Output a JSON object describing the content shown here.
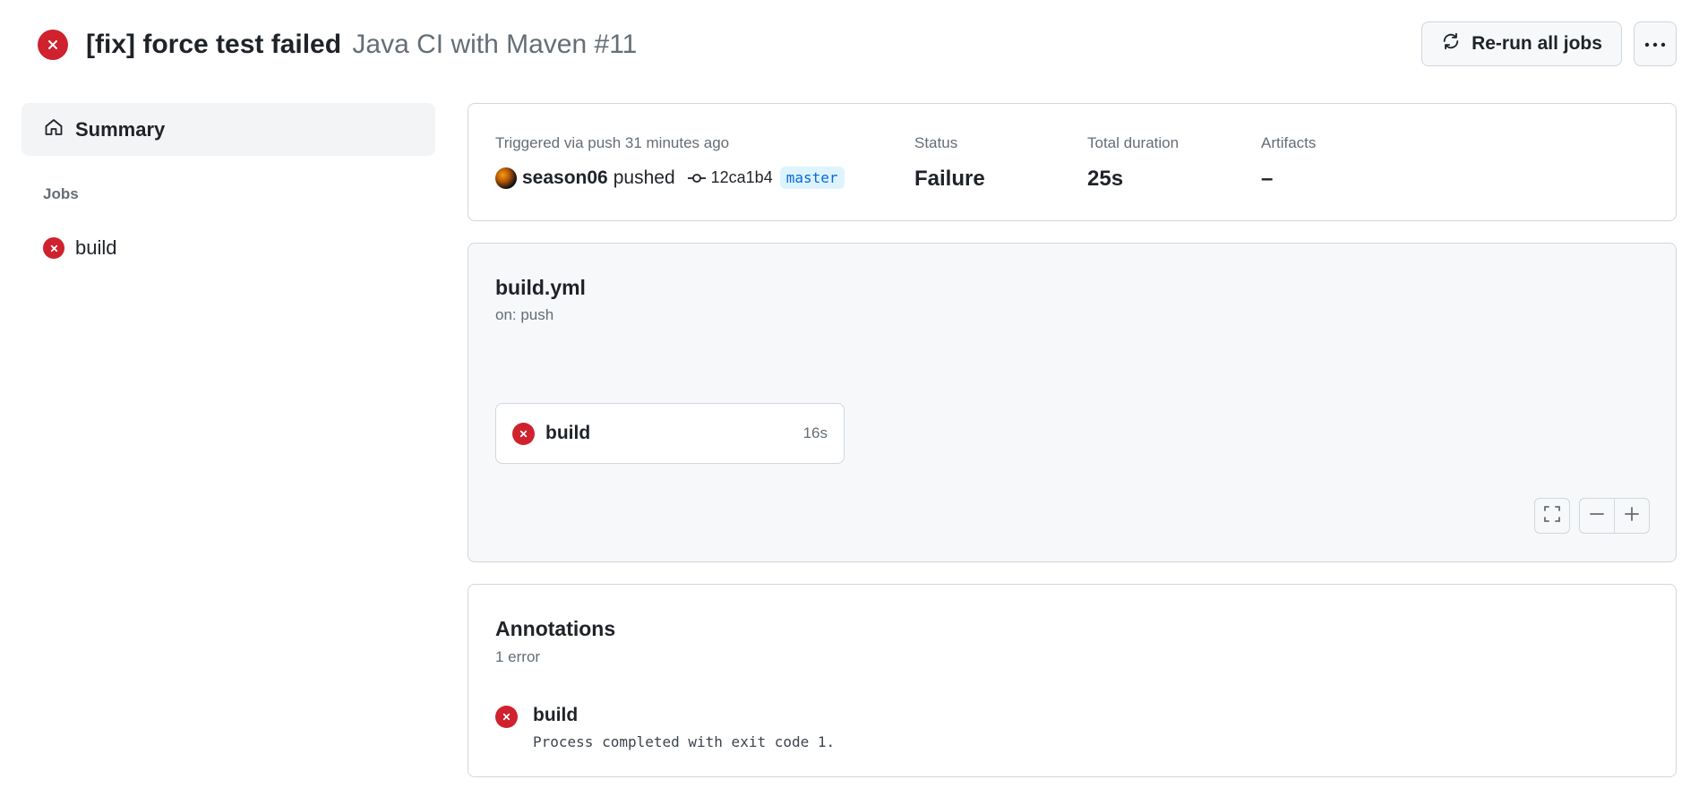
{
  "header": {
    "commit_title": "[fix] force test failed",
    "workflow_run": "Java CI with Maven #11",
    "rerun_label": "Re-run all jobs"
  },
  "sidebar": {
    "summary_label": "Summary",
    "jobs_heading": "Jobs",
    "jobs": [
      {
        "name": "build",
        "status": "failure"
      }
    ]
  },
  "run_summary": {
    "triggered_text": "Triggered via push 31 minutes ago",
    "actor": "season06",
    "action": "pushed",
    "commit_sha": "12ca1b4",
    "branch": "master",
    "status_label": "Status",
    "status_value": "Failure",
    "duration_label": "Total duration",
    "duration_value": "25s",
    "artifacts_label": "Artifacts",
    "artifacts_value": "–"
  },
  "workflow_graph": {
    "file": "build.yml",
    "trigger": "on: push",
    "job": {
      "name": "build",
      "duration": "16s",
      "status": "failure"
    }
  },
  "annotations": {
    "title": "Annotations",
    "count": "1 error",
    "items": [
      {
        "job": "build",
        "message": "Process completed with exit code 1."
      }
    ]
  },
  "colors": {
    "failure": "#cf222e",
    "accent": "#0969da",
    "muted": "#656d76"
  }
}
